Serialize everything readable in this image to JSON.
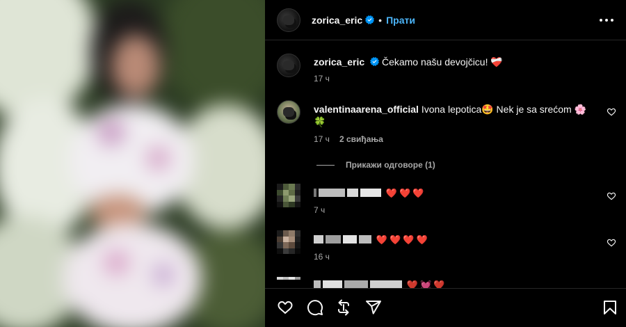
{
  "post": {
    "author": "zorica_eric",
    "follow_label": "Прати",
    "dot": "•"
  },
  "caption": {
    "username": "zorica_eric",
    "text": "Čekamo našu devojčicu! ❤️‍🩹",
    "time": "17 ч"
  },
  "comments": [
    {
      "username": "valentinaarena_official",
      "text": "Ivona lepotica🤩 Nek je sa srećom 🌸",
      "text_line2": "🍀",
      "time": "17 ч",
      "likes": "2 свиђања"
    },
    {
      "username": "",
      "text": "❤️❤️❤️",
      "time": "7 ч"
    },
    {
      "username": "",
      "text": "❤️❤️❤️❤️",
      "time": "16 ч"
    },
    {
      "username": "",
      "text": "❤️💓❤️",
      "time": ""
    }
  ],
  "view_replies": "Прикажи одговоре (1)",
  "icons": {
    "verified": "verified-badge-icon",
    "more": "more-options-icon",
    "like": "heart-icon",
    "comment": "comment-icon",
    "repost": "repost-icon",
    "share": "send-icon",
    "save": "bookmark-icon"
  },
  "colors": {
    "accent": "#4cb5f9",
    "background": "#000000",
    "heart_red": "#ed1c3a"
  }
}
